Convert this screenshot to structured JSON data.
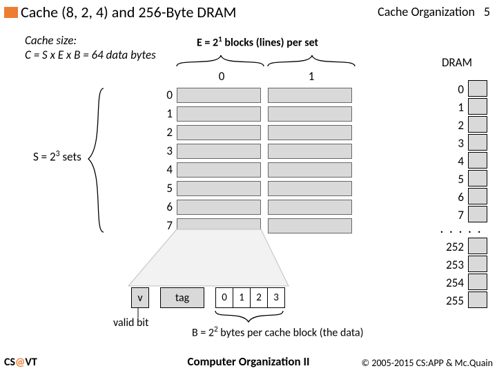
{
  "header": {
    "title": "Cache (8, 2, 4) and 256-Byte DRAM",
    "section": "Cache Organization",
    "page": "5"
  },
  "cache_size": {
    "line1": "Cache size:",
    "line2": "C = S x E x B = 64 data bytes"
  },
  "labels": {
    "E_prefix": "E = 2",
    "E_exp": "1",
    "E_suffix": " blocks (lines) per set",
    "col0": "0",
    "col1": "1",
    "dram": "DRAM",
    "S_prefix": "S = 2",
    "S_exp": "3",
    "S_suffix": " sets",
    "v": "v",
    "tag": "tag",
    "valid_bit": "valid bit",
    "B_prefix": "B = 2",
    "B_exp": "2",
    "B_suffix": " bytes per cache block (the data)"
  },
  "set_rows": [
    "0",
    "1",
    "2",
    "3",
    "4",
    "5",
    "6",
    "7"
  ],
  "bytes": [
    "0",
    "1",
    "2",
    "3"
  ],
  "dram_top": [
    "0",
    "1",
    "2",
    "3",
    "4",
    "5",
    "6",
    "7"
  ],
  "dram_dots": ". . . . .",
  "dram_bottom": [
    "252",
    "253",
    "254",
    "255"
  ],
  "footer": {
    "left_a": "CS",
    "left_at": "@",
    "left_b": "VT",
    "center": "Computer Organization II",
    "right": "© 2005-2015 CS:APP & Mc.Quain"
  }
}
